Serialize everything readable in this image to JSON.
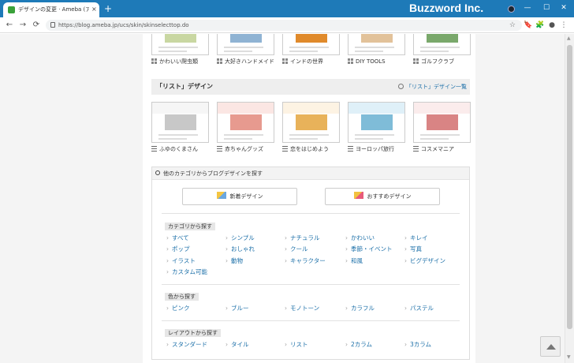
{
  "browser": {
    "tab_title": "デザインの変更 · Ameba (アメーバ)",
    "tab_close": "×",
    "new_tab": "+",
    "brand": "Buzzword Inc.",
    "url": "https://blog.ameba.jp/ucs/skin/skinselecttop.do",
    "window_controls": {
      "minimize": "—",
      "maximize": "☐",
      "close": "✕"
    },
    "nav_icons": {
      "back": "←",
      "forward": "→",
      "reload": "⟳",
      "star": "☆"
    },
    "toolbar_icons": [
      "🔖",
      "🧩",
      "●",
      "⋮"
    ]
  },
  "top_row": [
    {
      "label": "かわいい爬虫類",
      "colors": [
        "#f0f0e8",
        "#c9d7a2"
      ]
    },
    {
      "label": "大好きハンドメイド",
      "colors": [
        "#f7f7f7",
        "#8fb3d3"
      ]
    },
    {
      "label": "インドの世界",
      "colors": [
        "#f5c43a",
        "#e08a2b"
      ]
    },
    {
      "label": "DIY TOOLS",
      "colors": [
        "#c99b6c",
        "#e2c29a"
      ]
    },
    {
      "label": "ゴルフクラブ",
      "colors": [
        "#f0f4ea",
        "#7aa86b"
      ]
    }
  ],
  "list_section": {
    "title": "「リスト」デザイン",
    "more_link": "「リスト」デザイン一覧",
    "items": [
      {
        "label": "ふゆのくまさん",
        "colors": [
          "#f6f6f6",
          "#c8c8c8"
        ]
      },
      {
        "label": "赤ちゃんグッズ",
        "colors": [
          "#fbe6e3",
          "#e79a8f"
        ]
      },
      {
        "label": "恋をはじめよう",
        "colors": [
          "#fdf3e3",
          "#e8b25a"
        ]
      },
      {
        "label": "ヨーロッパ旅行",
        "colors": [
          "#dff0f8",
          "#7fbcd8"
        ]
      },
      {
        "label": "コスメマニア",
        "colors": [
          "#fbecec",
          "#d98484"
        ]
      }
    ]
  },
  "finder": {
    "title": "他のカテゴリからブログデザインを探す",
    "btn_new": "新着デザイン",
    "btn_recommend": "おすすめデザイン",
    "category_head": "カテゴリから探す",
    "categories": [
      "すべて",
      "シンプル",
      "ナチュラル",
      "かわいい",
      "キレイ",
      "ポップ",
      "おしゃれ",
      "クール",
      "季節・イベント",
      "写真",
      "イラスト",
      "動物",
      "キャラクター",
      "和風",
      "ビグデザイン",
      "カスタム可能"
    ],
    "color_head": "色から探す",
    "colors": [
      "ピンク",
      "ブルー",
      "モノトーン",
      "カラフル",
      "パステル"
    ],
    "layout_head": "レイアウトから探す",
    "layouts": [
      "スタンダード",
      "タイル",
      "リスト",
      "2カラム",
      "3カラム"
    ]
  },
  "colors": {
    "titlebar": "#1e7ab8",
    "link": "#1b6fa8"
  }
}
